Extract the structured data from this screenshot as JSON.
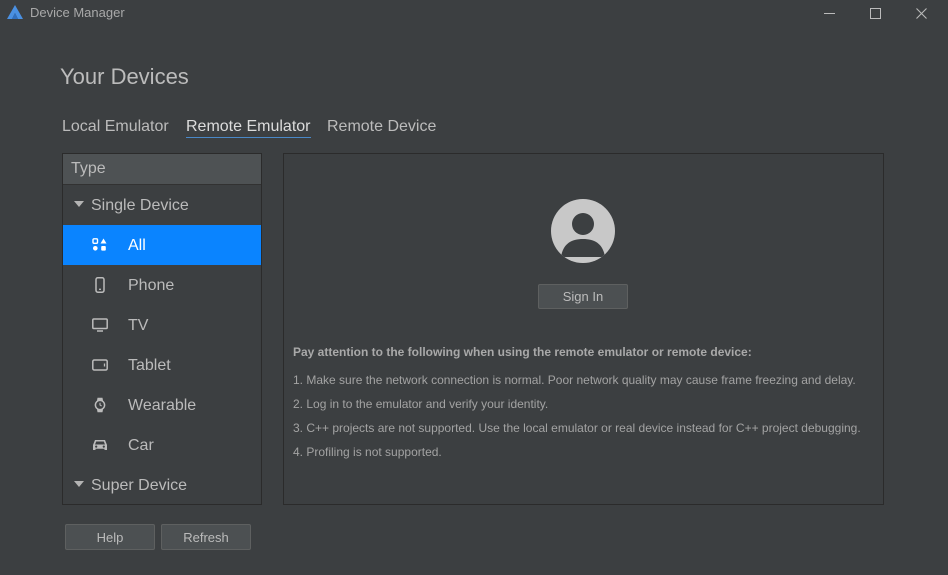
{
  "window": {
    "title": "Device Manager",
    "controls": {
      "minimize_icon": "minimize-icon",
      "maximize_icon": "maximize-icon",
      "close_icon": "close-icon"
    }
  },
  "page": {
    "title": "Your Devices"
  },
  "tabs": [
    {
      "label": "Local Emulator",
      "active": false
    },
    {
      "label": "Remote Emulator",
      "active": true
    },
    {
      "label": "Remote Device",
      "active": false
    }
  ],
  "type_panel": {
    "header": "Type",
    "groups": [
      {
        "label": "Single Device",
        "expanded": true,
        "items": [
          {
            "label": "All",
            "icon": "apps-icon",
            "selected": true
          },
          {
            "label": "Phone",
            "icon": "phone-icon",
            "selected": false
          },
          {
            "label": "TV",
            "icon": "tv-icon",
            "selected": false
          },
          {
            "label": "Tablet",
            "icon": "tablet-icon",
            "selected": false
          },
          {
            "label": "Wearable",
            "icon": "watch-icon",
            "selected": false
          },
          {
            "label": "Car",
            "icon": "car-icon",
            "selected": false
          }
        ]
      },
      {
        "label": "Super Device",
        "expanded": true,
        "items": []
      }
    ]
  },
  "content": {
    "avatar_icon": "user-avatar-icon",
    "sign_in_label": "Sign In",
    "notes_title": "Pay attention to the following when using the remote emulator or remote device:",
    "notes": [
      "1. Make sure the network connection is normal. Poor network quality may cause frame freezing and delay.",
      "2. Log in to the emulator and verify your identity.",
      "3. C++ projects are not supported. Use the local emulator or real device instead for C++ project debugging.",
      "4. Profiling is not supported."
    ]
  },
  "footer": {
    "help_label": "Help",
    "refresh_label": "Refresh"
  },
  "colors": {
    "background": "#3c3f41",
    "selection": "#0a84ff",
    "tab_underline": "#4a88c7",
    "logo": "#4a90e2"
  }
}
